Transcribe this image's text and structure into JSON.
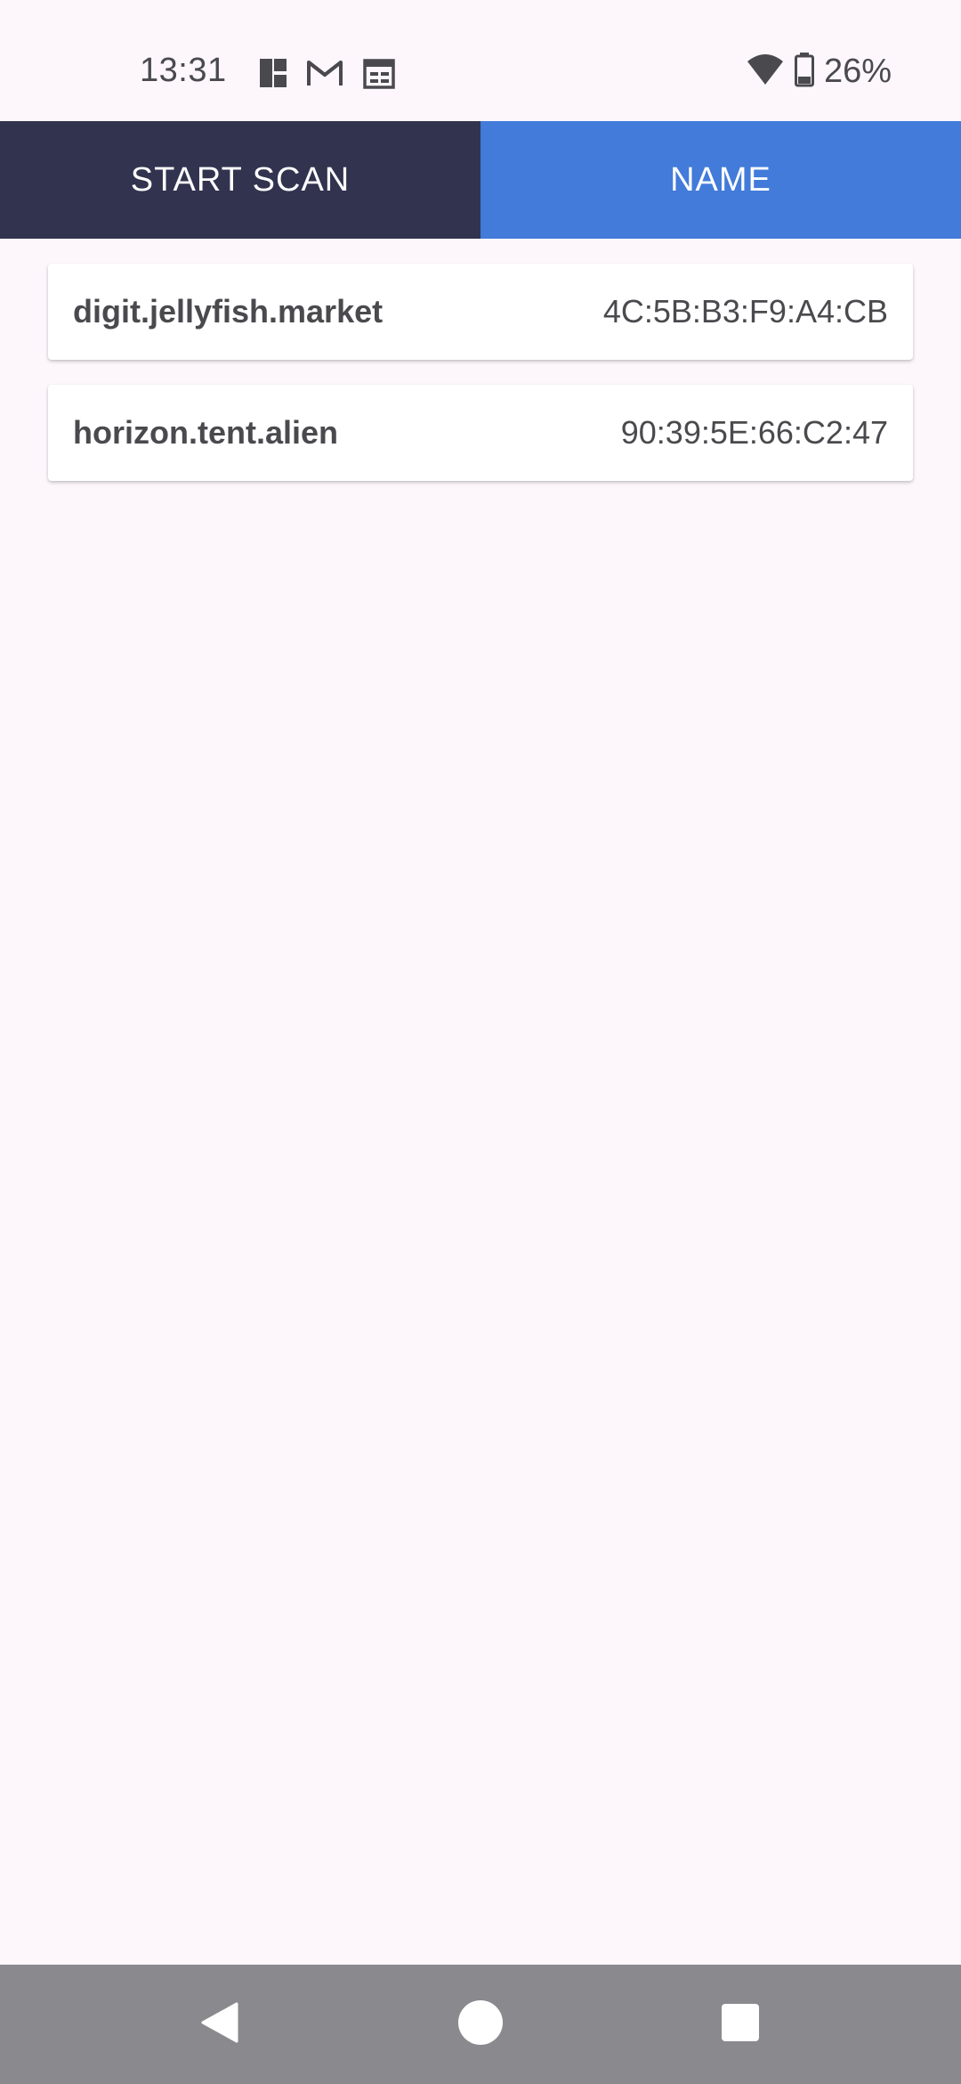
{
  "status_bar": {
    "time": "13:31",
    "battery_percent": "26%",
    "notification_icons": [
      "squares-icon",
      "gmail-icon",
      "calendar-icon"
    ]
  },
  "tabs": {
    "start_scan_label": "START SCAN",
    "name_label": "NAME",
    "start_scan_color": "#31334f",
    "name_color": "#427bd9"
  },
  "devices": [
    {
      "name": "digit.jellyfish.market",
      "mac": "4C:5B:B3:F9:A4:CB"
    },
    {
      "name": "horizon.tent.alien",
      "mac": "90:39:5E:66:C2:47"
    }
  ],
  "nav_bar": {
    "buttons": [
      "back-icon",
      "home-icon",
      "recents-icon"
    ]
  }
}
